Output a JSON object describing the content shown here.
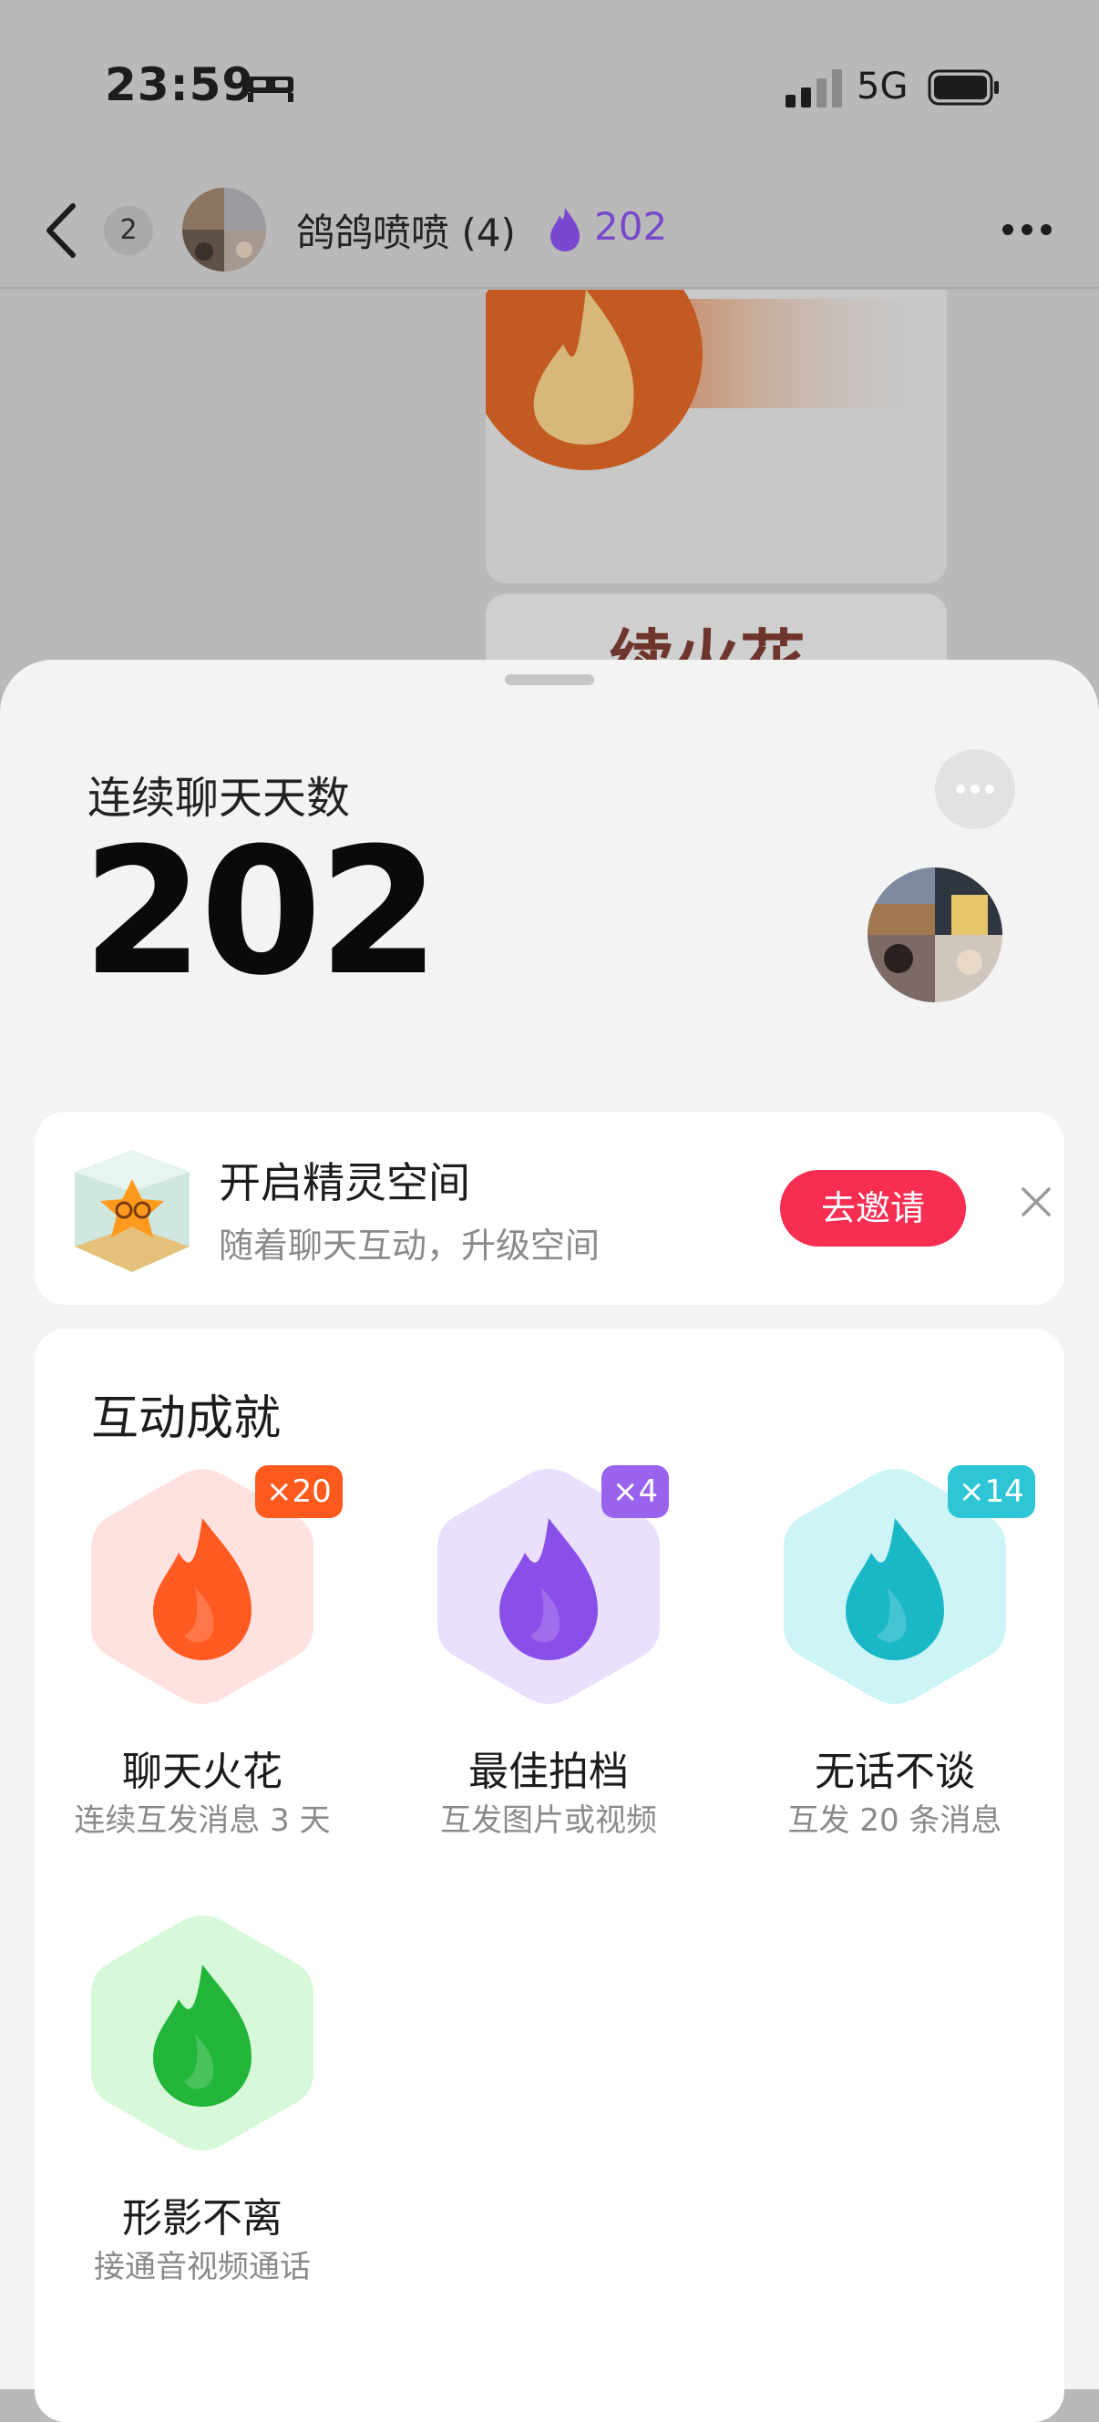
{
  "status_bar": {
    "time": "23:59",
    "network": "5G"
  },
  "chat_header": {
    "unread_count": "2",
    "title": "鸽鸽喷喷 (4)",
    "streak_count": "202"
  },
  "background_message": {
    "text": "续火花"
  },
  "sheet": {
    "streak_label": "连续聊天天数",
    "streak_value": "202",
    "spirit_card": {
      "title": "开启精灵空间",
      "subtitle": "随着聊天互动，升级空间",
      "invite_label": "去邀请"
    },
    "achievements": {
      "title": "互动成就",
      "items": [
        {
          "name": "聊天火花",
          "desc": "连续互发消息 3 天",
          "badge": "×20",
          "color": "#ff5a22",
          "badge_color": "#ff5a1e",
          "hex_bg": "#ffe2e0"
        },
        {
          "name": "最佳拍档",
          "desc": "互发图片或视频",
          "badge": "×4",
          "color": "#8a4fe8",
          "badge_color": "#9a63ee",
          "hex_bg": "#eadffc"
        },
        {
          "name": "无话不谈",
          "desc": "互发 20 条消息",
          "badge": "×14",
          "color": "#1ab8c6",
          "badge_color": "#2ec6d6",
          "hex_bg": "#cdf4f7"
        },
        {
          "name": "形影不离",
          "desc": "接通音视频通话",
          "badge": "",
          "color": "#22b53a",
          "badge_color": "",
          "hex_bg": "#d7f9d9"
        }
      ]
    }
  }
}
